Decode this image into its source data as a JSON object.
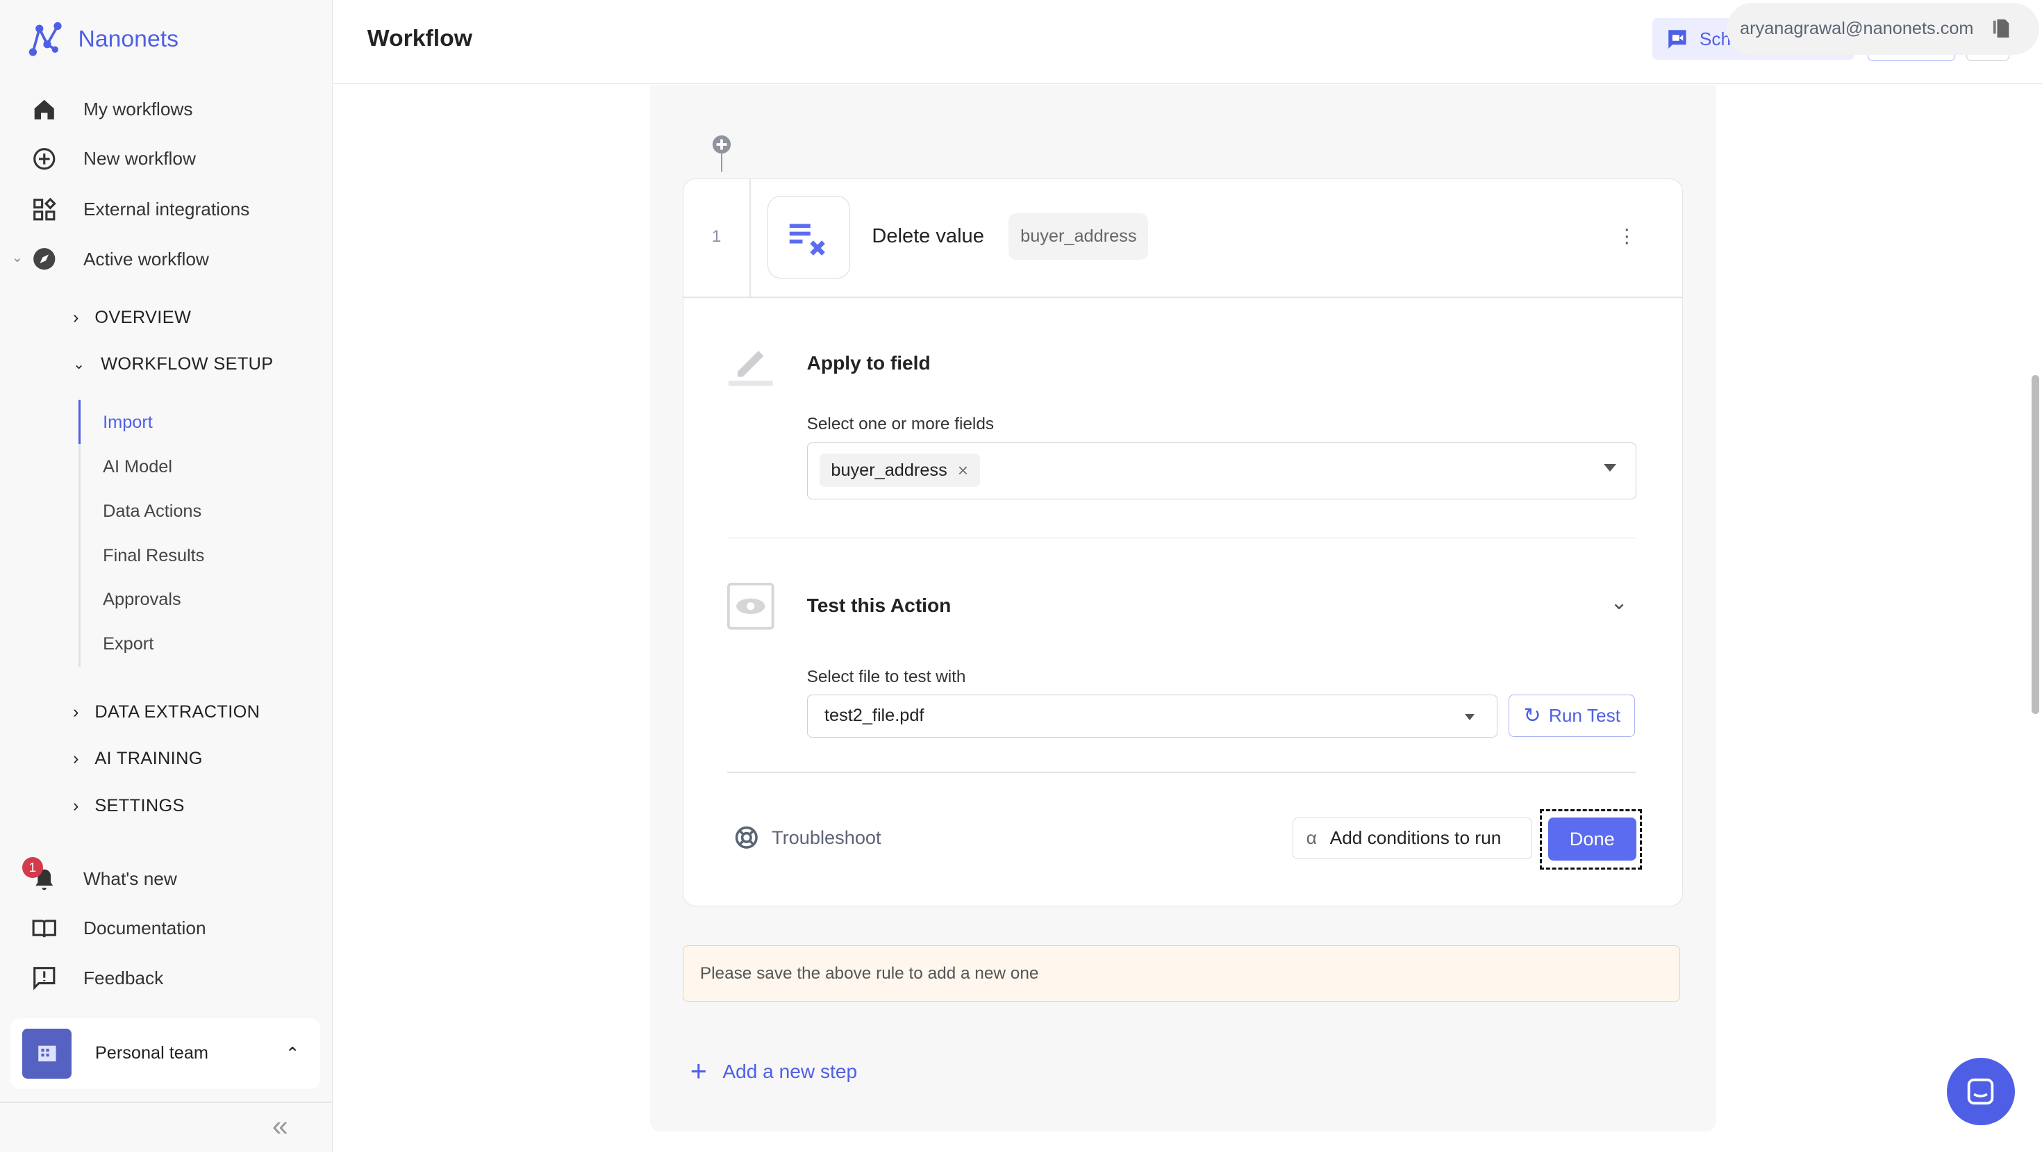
{
  "brand": {
    "name": "Nanonets",
    "accent": "#4e5fe6"
  },
  "sidebar": {
    "nav": [
      {
        "label": "My workflows",
        "icon": "home-icon"
      },
      {
        "label": "New workflow",
        "icon": "plus-circle-icon"
      },
      {
        "label": "External integrations",
        "icon": "grid-icon"
      },
      {
        "label": "Active workflow",
        "icon": "compass-icon"
      }
    ],
    "sections": [
      "OVERVIEW",
      "WORKFLOW SETUP",
      "DATA EXTRACTION",
      "AI TRAINING",
      "SETTINGS"
    ],
    "setup_items": [
      "Import",
      "AI Model",
      "Data Actions",
      "Final Results",
      "Approvals",
      "Export"
    ],
    "active_item": "Import",
    "bottom": [
      {
        "label": "What's new",
        "icon": "bell-icon",
        "badge": "1"
      },
      {
        "label": "Documentation",
        "icon": "book-icon"
      },
      {
        "label": "Feedback",
        "icon": "feedback-icon"
      }
    ],
    "team": "Personal team"
  },
  "header": {
    "title": "Workflow",
    "schedule_label": "Sch",
    "email": "aryanagrawal@nanonets.com"
  },
  "step": {
    "number": "1",
    "title": "Delete value",
    "tag": "buyer_address",
    "apply": {
      "heading": "Apply to field",
      "label": "Select one or more fields",
      "chips": [
        "buyer_address"
      ]
    },
    "test": {
      "heading": "Test this Action",
      "label": "Select file to test with",
      "file": "test2_file.pdf",
      "run_label": "Run Test"
    },
    "troubleshoot": "Troubleshoot",
    "conditions_label": "Add conditions to run",
    "done_label": "Done"
  },
  "notice": "Please save the above rule to add a new one",
  "add_step": "Add a new step"
}
